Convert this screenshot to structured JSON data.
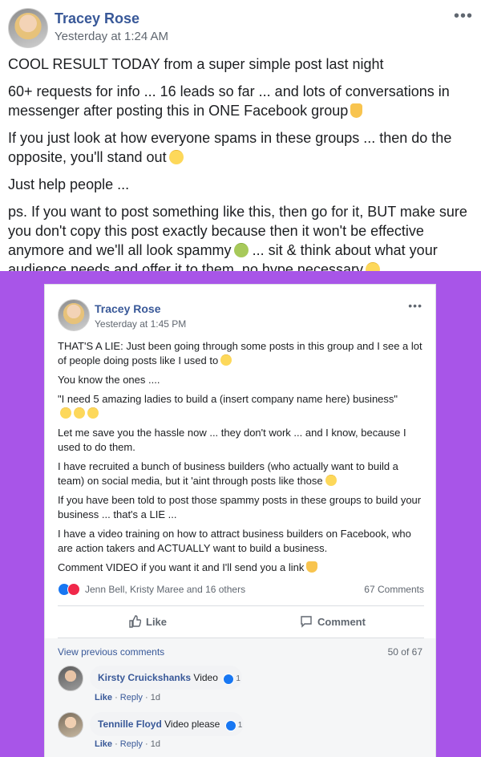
{
  "post": {
    "author": "Tracey Rose",
    "timestamp": "Yesterday at 1:24 AM",
    "more_icon": "•••",
    "paragraphs": [
      "COOL RESULT TODAY from a super simple post last night",
      "60+ requests for info ... 16 leads so far ... and lots of conversations in messenger after posting this in ONE Facebook group",
      "If you just look at how everyone spams in these groups ... then do the opposite, you'll stand out",
      "Just help people ...",
      "ps. If you want to post something like this, then go for it, BUT make sure you don't copy this post exactly because then it won't be effective anymore and we'll all look spammy",
      "... sit & think about what your audience needs and offer it to them, no hype necessary"
    ]
  },
  "embedded_post": {
    "author": "Tracey Rose",
    "timestamp": "Yesterday at 1:45 PM",
    "more_icon": "•••",
    "paragraphs": [
      "THAT'S A LIE: Just been going through some posts in this group and I see a lot of people doing posts like I used to",
      "You know the ones ....",
      "\"I need 5 amazing ladies to build a (insert company name here) business\"",
      "Let me save you the hassle now ... they don't work ... and I know, because I used to do them.",
      "I have recruited a bunch of business builders (who actually want to build a team) on social media, but it 'aint through posts like those",
      "If you have been told to post those spammy posts in these groups to build your business ... that's a LIE ...",
      "I have a video training on how to attract business builders on Facebook, who are action takers and ACTUALLY want to build a business.",
      "Comment VIDEO if you want it and I'll send you a link"
    ],
    "reactions_names": "Jenn Bell, Kristy Maree and 16 others",
    "comments_count": "67 Comments",
    "like_label": "Like",
    "comment_label": "Comment",
    "view_previous": "View previous comments",
    "page_count": "50 of 67",
    "comments": [
      {
        "name": "Kirsty Cruickshanks",
        "text": "Video",
        "reactions": "1",
        "like": "Like",
        "reply": "Reply",
        "age": "1d"
      },
      {
        "name": "Tennille Floyd",
        "text": "Video please",
        "reactions": "1",
        "like": "Like",
        "reply": "Reply",
        "age": "1d"
      }
    ]
  },
  "colors": {
    "background_band": "#a855e8",
    "name_link": "#385898",
    "meta_text": "#606770"
  },
  "icons": [
    "avatar",
    "more-icon",
    "pointing-hand-emoji",
    "wink-emoji",
    "sick-emoji",
    "kiss-emoji",
    "like-reaction-icon",
    "love-reaction-icon",
    "thumbs-up-icon",
    "comment-bubble-icon"
  ]
}
